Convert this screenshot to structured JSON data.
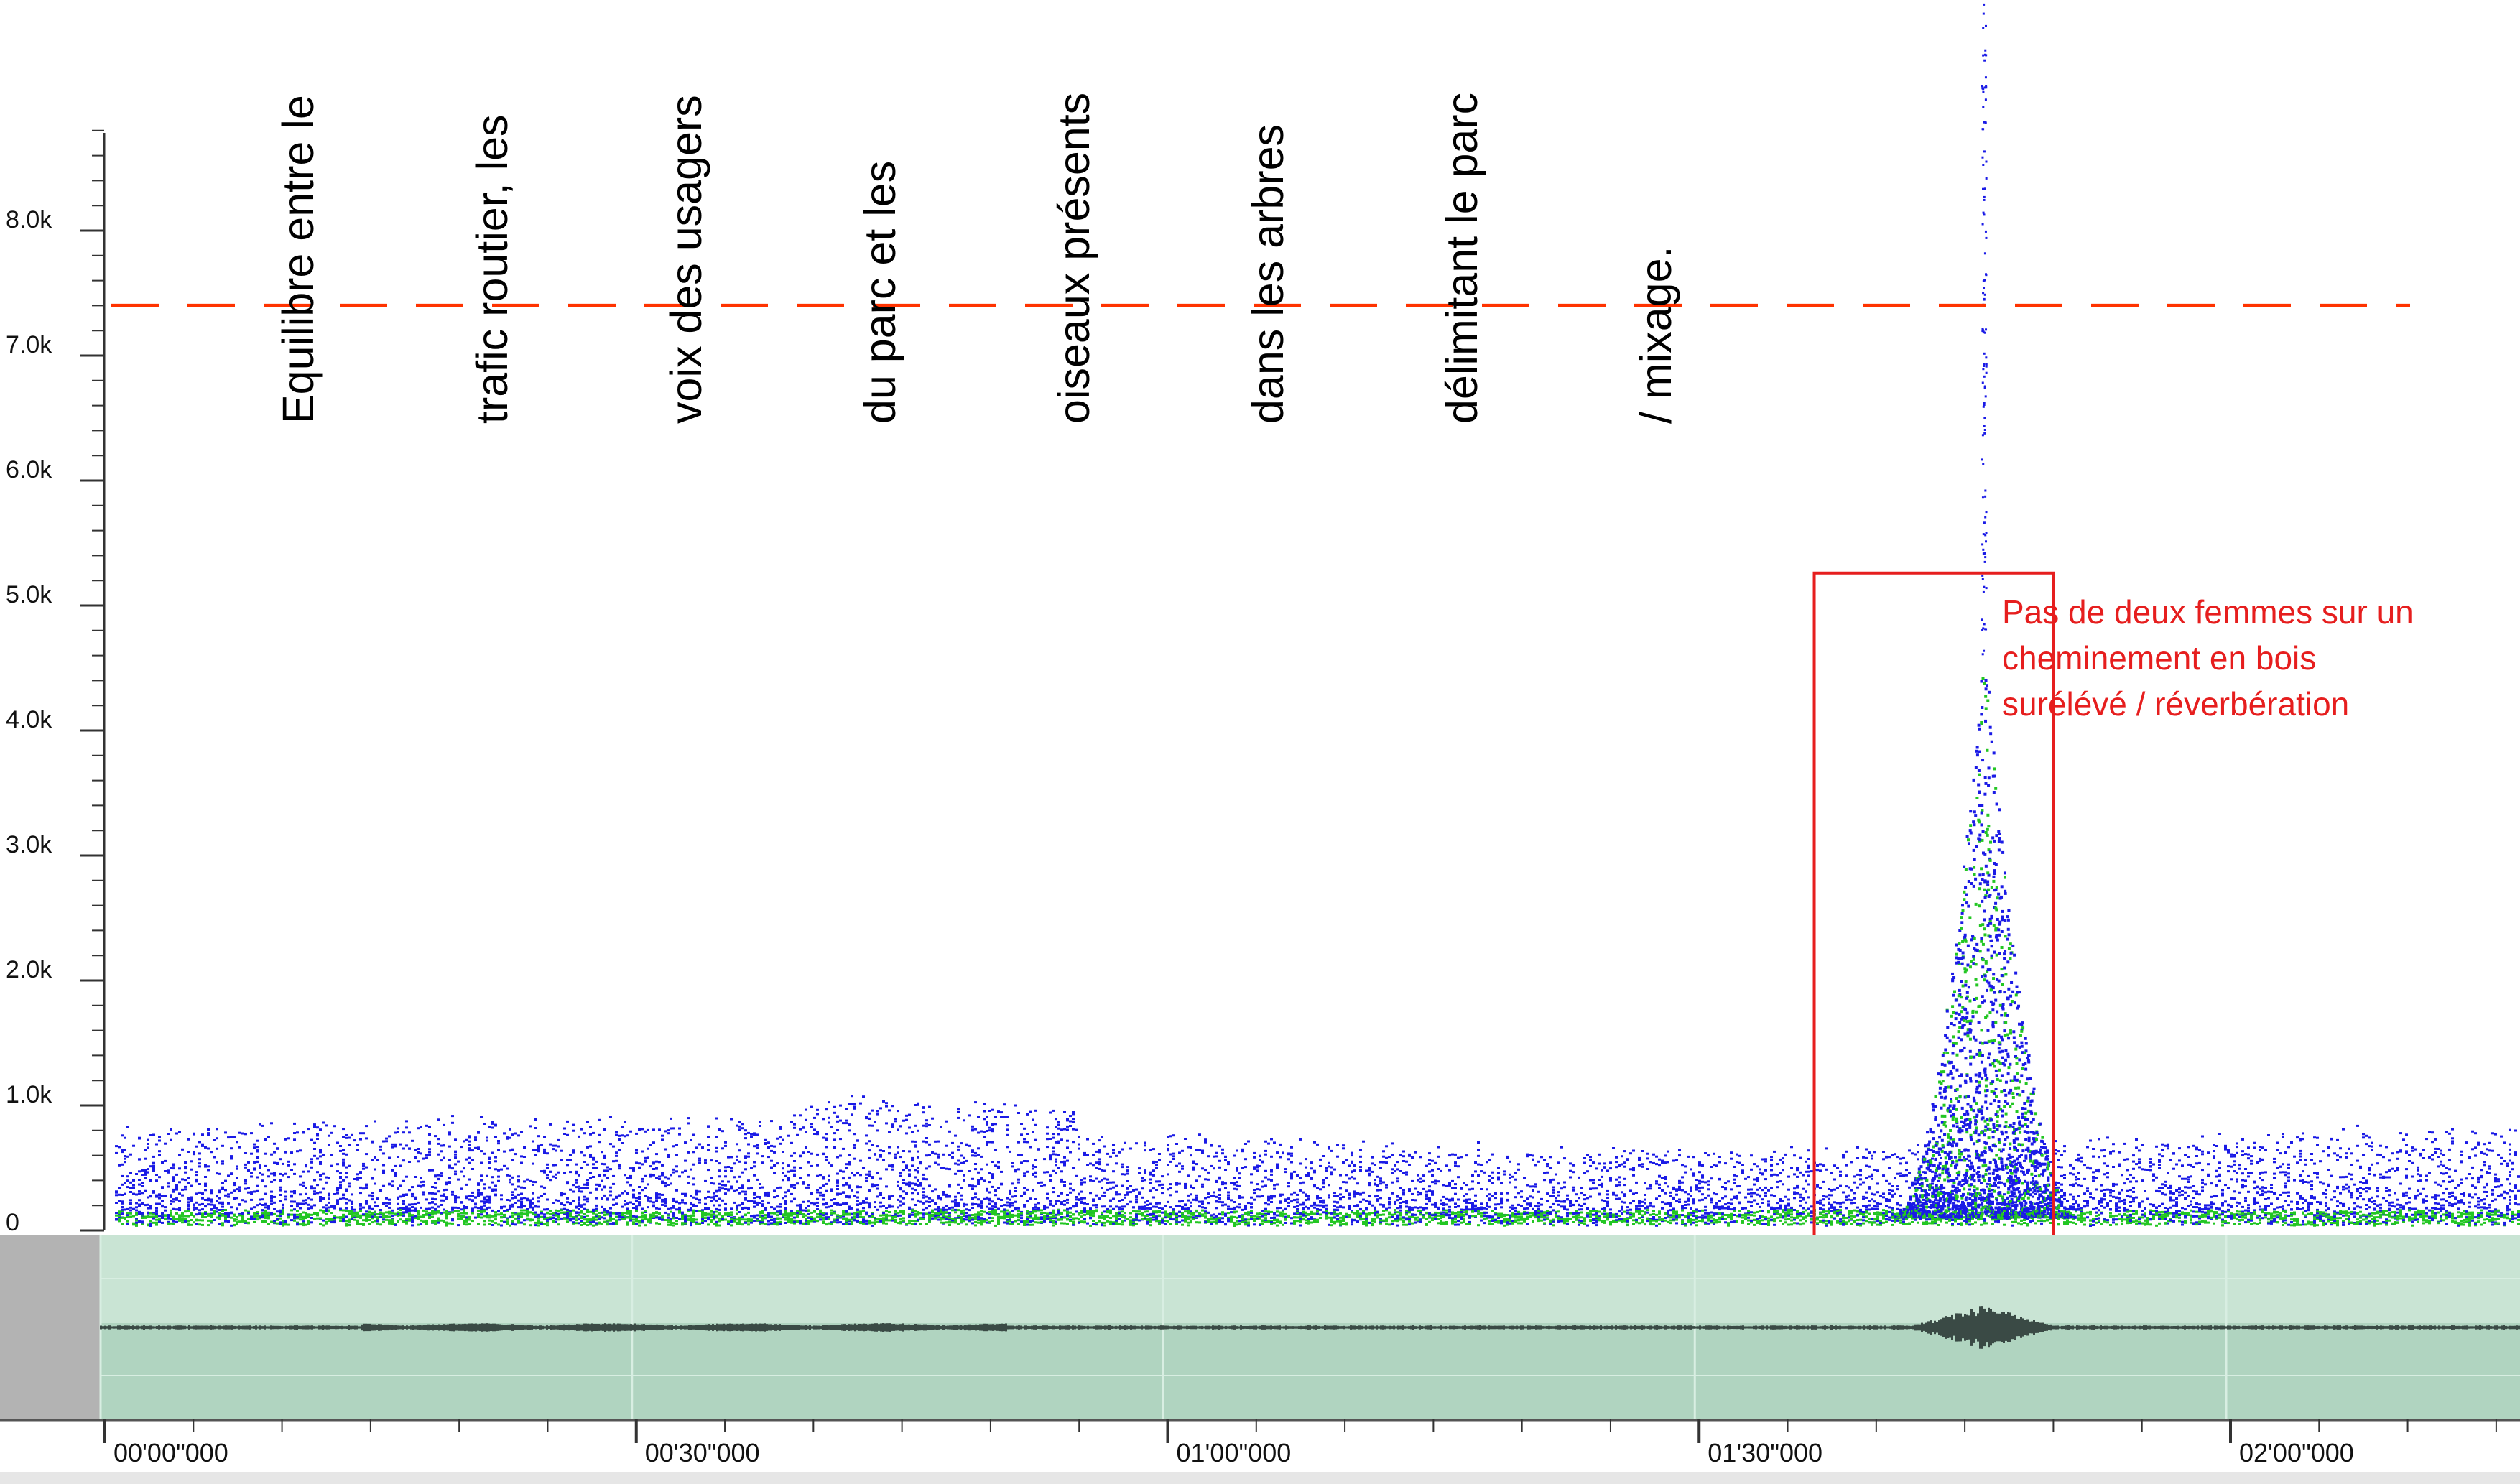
{
  "spectrogram": {
    "y_axis_labels": [
      "8.0k",
      "7.0k",
      "6.0k",
      "5.0k",
      "4.0k",
      "3.0k",
      "2.0k",
      "1.0k",
      "0"
    ],
    "y_axis_values": [
      8000,
      7000,
      6000,
      5000,
      4000,
      3000,
      2000,
      1000,
      0
    ],
    "y_max": 8800,
    "threshold_hz": 7400,
    "threshold_color": "#ff3300",
    "highlight_color": "#e61e1e",
    "highlight_range": {
      "t_start": 96.5,
      "t_end": 110,
      "f_low": -230,
      "f_high": 5260
    },
    "duration_s": 143,
    "energy_colors": {
      "low": "#1a1ae6",
      "mid": "#23c623"
    }
  },
  "annotations": {
    "vertical_note_lines": [
      "Equilibre entre le",
      "trafic routier, les",
      "voix des usagers",
      "du parc et les",
      "oiseaux présents",
      "dans les arbres",
      "délimitant le parc",
      "/ mixage."
    ],
    "box_note_lines": [
      "Pas de deux femmes sur un",
      "cheminement en bois",
      "surélévé / réverbération"
    ]
  },
  "waveform": {
    "background": "#b0d4c0",
    "peak_time_s": 106
  },
  "timeline": {
    "labels": [
      "00'00\"000",
      "00'30\"000",
      "01'00\"000",
      "01'30\"000",
      "02'00\"000"
    ],
    "label_times_s": [
      0,
      30,
      60,
      90,
      120
    ]
  }
}
